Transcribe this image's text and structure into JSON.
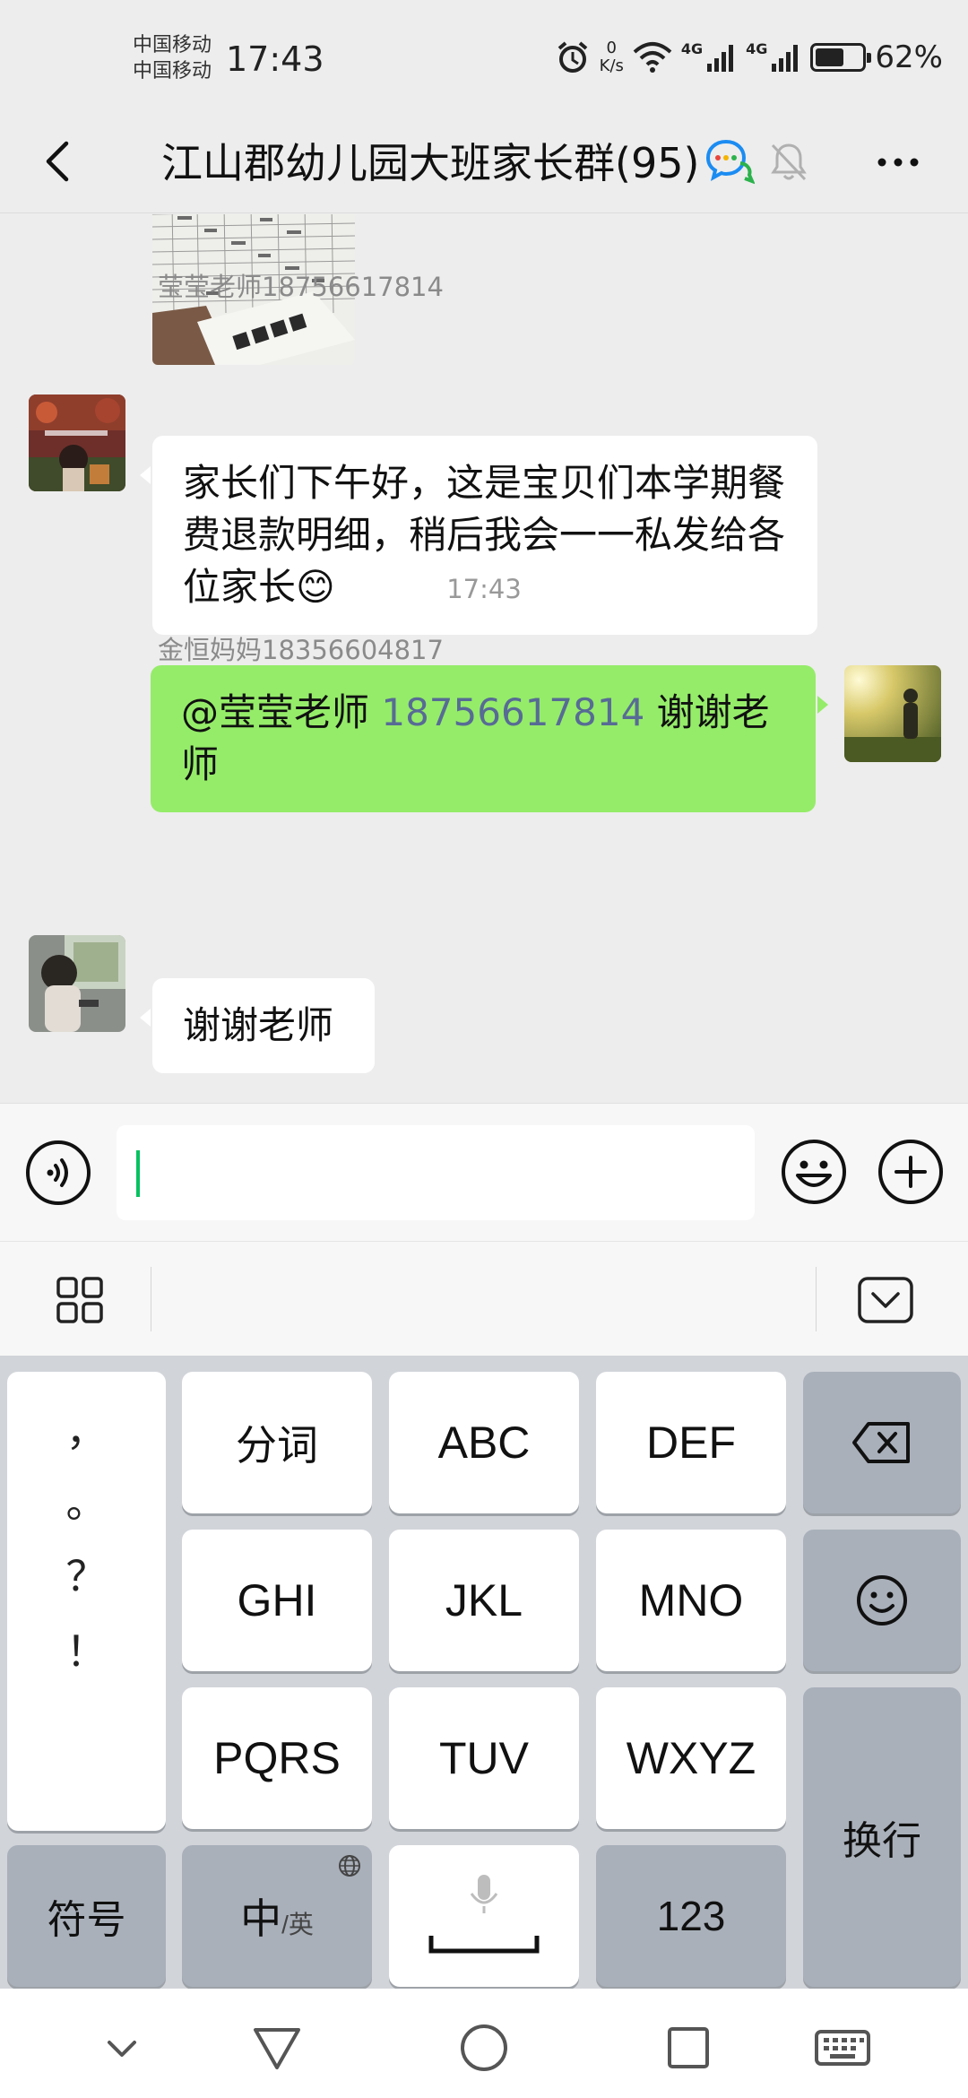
{
  "status_bar": {
    "carrier1": "中国移动",
    "carrier2": "中国移动",
    "time": "17:43",
    "net_speed_value": "0",
    "net_speed_unit": "K/s",
    "signal1_label": "4G",
    "signal2_label": "4G",
    "battery": "62%",
    "battery_level": 0.62
  },
  "header": {
    "title": "江山郡幼儿园大班家长群(95)"
  },
  "messages": [
    {
      "sender": "莹莹老师18756617814",
      "text": "家长们下午好，这是宝贝们本学期餐费退款明细，稍后我会一一私发给各位家长😊"
    },
    {
      "mention": "@莹莹老师 ",
      "mention_number": "18756617814",
      "text": " 谢谢老师"
    },
    {
      "timestamp": "17:43"
    },
    {
      "sender": "金恒妈妈18356604817",
      "text": "谢谢老师"
    }
  ],
  "keyboard": {
    "punct": [
      "，",
      "。",
      "？",
      "！"
    ],
    "row1": [
      "分词",
      "ABC",
      "DEF"
    ],
    "row2": [
      "GHI",
      "JKL",
      "MNO"
    ],
    "row3": [
      "PQRS",
      "TUV",
      "WXYZ"
    ],
    "symbols": "符号",
    "lang_main": "中",
    "lang_alt": "/英",
    "numbers": "123",
    "enter": "换行"
  },
  "icons": {
    "back": "back-arrow-icon",
    "chat_bubbles": "group-chat-icon",
    "mute": "mute-bell-icon",
    "more": "more-dots-icon",
    "voice": "voice-input-icon",
    "emoji": "emoji-icon",
    "plus": "plus-icon",
    "grid": "app-grid-icon",
    "hide_keyboard": "hide-keyboard-icon",
    "backspace": "backspace-icon",
    "keyboard_emoji": "keyboard-emoji-icon",
    "mic": "microphone-icon",
    "globe": "globe-icon"
  },
  "colors": {
    "outgoing_bubble": "#95ec69",
    "incoming_bubble": "#ffffff",
    "chat_background": "#ededed",
    "mention_number": "#576b95",
    "cursor": "#07c160"
  }
}
